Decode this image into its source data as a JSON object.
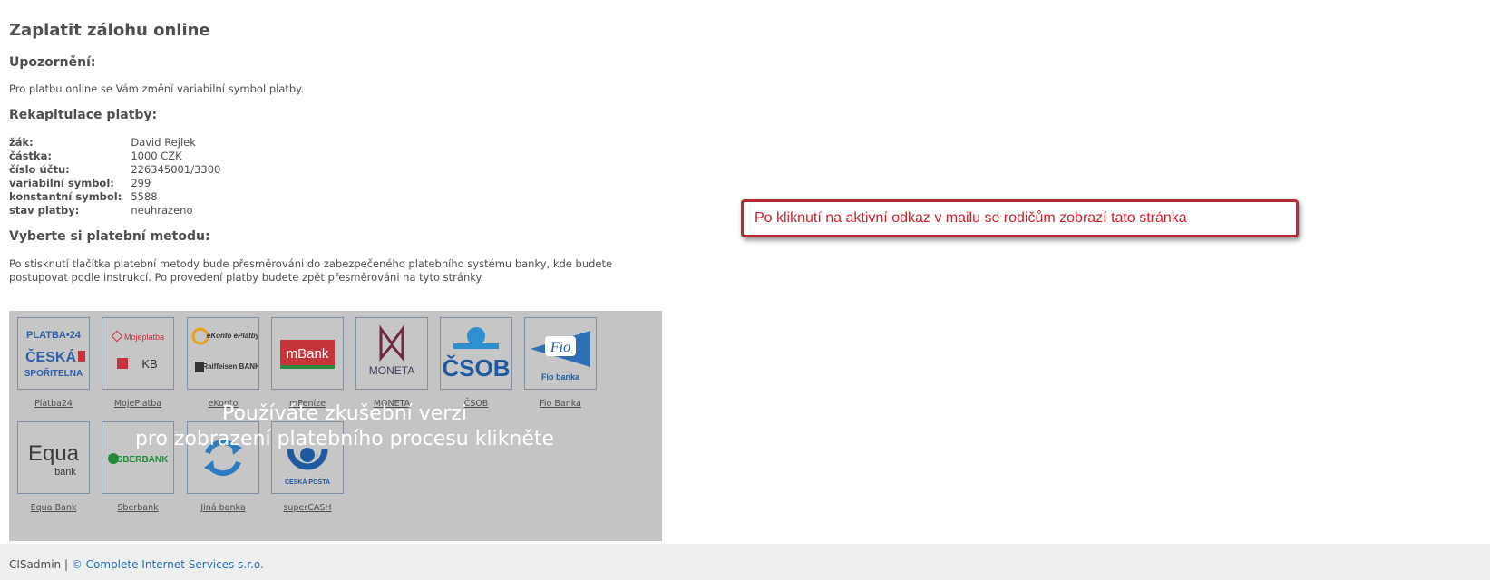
{
  "page": {
    "title": "Zaplatit zálohu online",
    "warning_heading": "Upozornění:",
    "warning_text": "Pro platbu online se Vám změní variabilní symbol platby.",
    "recap_heading": "Rekapitulace platby:",
    "recap": [
      {
        "label": "žák:",
        "value": "David Rejlek"
      },
      {
        "label": "částka:",
        "value": "1000 CZK"
      },
      {
        "label": "číslo účtu:",
        "value": "226345001/3300"
      },
      {
        "label": "variabilní symbol:",
        "value": "299"
      },
      {
        "label": "konstantní symbol:",
        "value": "5588"
      },
      {
        "label": "stav platby:",
        "value": "neuhrazeno"
      }
    ],
    "method_heading": "Vyberte si platební metodu:",
    "method_text": "Po stisknutí tlačítka platební metody bude přesměrováni do zabezpečeného platebního systému banky, kde budete postupovat podle instrukcí. Po provedení platby budete zpět přesměrováni na tyto stránky."
  },
  "methods": [
    {
      "label": "Platba24",
      "logo": [
        "PLATBA•24",
        "ČESKÁ",
        "SPOŘITELNA"
      ],
      "color": "#2e5fa8"
    },
    {
      "label": "MojePlatba",
      "logo": [
        "Mojeplatba",
        "KB"
      ],
      "color": "#c8323a"
    },
    {
      "label": "eKonto",
      "logo": [
        "eKonto ePlatby",
        "Raiffeisen BANK"
      ],
      "color": "#333333"
    },
    {
      "label": "mPeníze",
      "logo": [
        "mBank"
      ],
      "color": "#c5353a"
    },
    {
      "label": "MONETA",
      "logo": [
        "MONETA"
      ],
      "color": "#4a3a5e"
    },
    {
      "label": "ČSOB",
      "logo": [
        "ČSOB"
      ],
      "color": "#1e5aa0"
    },
    {
      "label": "Fio Banka",
      "logo": [
        "Fio",
        "Fio banka"
      ],
      "color": "#1e5aa0"
    },
    {
      "label": "Equa Bank",
      "logo": [
        "Equa",
        "bank"
      ],
      "color": "#3c3c3c"
    },
    {
      "label": "Sberbank",
      "logo": [
        "SBERBANK"
      ],
      "color": "#1f8a3a"
    },
    {
      "label": "Jiná banka",
      "logo": [],
      "color": "#2e7cc0"
    },
    {
      "label": "superCASH",
      "logo": [
        "ČESKÁ POŠTA"
      ],
      "color": "#1e5aa0"
    }
  ],
  "overlay": {
    "line1": "Používáte zkušební verzi",
    "line2": "pro zobrazení platebního procesu klikněte"
  },
  "callout": {
    "text": "Po kliknutí na aktivní odkaz v mailu se rodičům zobrazí tato stránka"
  },
  "footer": {
    "app": "CISadmin",
    "separator": "|",
    "copyright": "© Complete Internet Services s.r.o."
  }
}
